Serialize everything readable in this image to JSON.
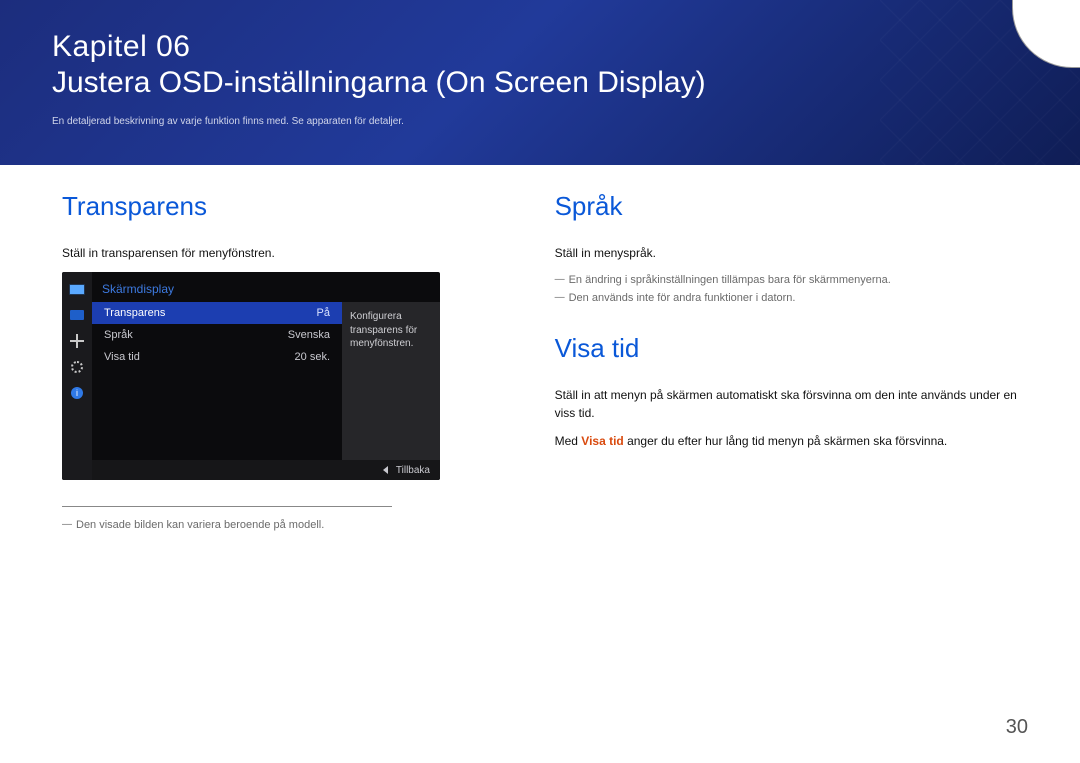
{
  "banner": {
    "chapter": "Kapitel 06",
    "title": "Justera OSD-inställningarna (On Screen Display)",
    "note": "En detaljerad beskrivning av varje funktion finns med. Se apparaten för detaljer."
  },
  "left": {
    "heading": "Transparens",
    "intro": "Ställ in transparensen för menyfönstren.",
    "footnote": "Den visade bilden kan variera beroende på modell."
  },
  "osd": {
    "header": "Skärmdisplay",
    "rows": [
      {
        "label": "Transparens",
        "value": "På",
        "selected": true
      },
      {
        "label": "Språk",
        "value": "Svenska",
        "selected": false
      },
      {
        "label": "Visa tid",
        "value": "20 sek.",
        "selected": false
      }
    ],
    "description": "Konfigurera transparens för menyfönstren.",
    "back": "Tillbaka"
  },
  "right": {
    "sprak": {
      "heading": "Språk",
      "intro": "Ställ in menyspråk.",
      "note1": "En ändring i språkinställningen tillämpas bara för skärmmenyerna.",
      "note2": "Den används inte för andra funktioner i datorn."
    },
    "visatid": {
      "heading": "Visa tid",
      "p1": "Ställ in att menyn på skärmen automatiskt ska försvinna om den inte används under en viss tid.",
      "p2_prefix": "Med ",
      "p2_highlight": "Visa tid",
      "p2_suffix": " anger du efter hur lång tid menyn på skärmen ska försvinna."
    }
  },
  "page_number": "30"
}
